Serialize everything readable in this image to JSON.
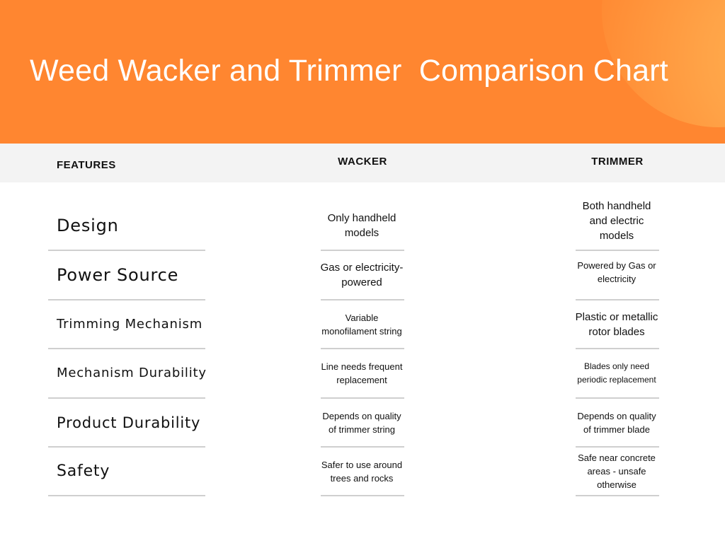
{
  "title": "Weed Wacker and Trimmer  Comparison Chart",
  "colors": {
    "banner": "#ff8630",
    "header_band": "#f3f3f3",
    "divider": "#cfcfcf"
  },
  "columns": {
    "features": "FEATURES",
    "wacker": "WACKER",
    "trimmer": "TRIMMER"
  },
  "rows": [
    {
      "feature": "Design",
      "wacker": "Only handheld models",
      "trimmer": "Both handheld and electric models"
    },
    {
      "feature": "Power Source",
      "wacker": "Gas or electricity-powered",
      "trimmer": "Powered by Gas or electricity"
    },
    {
      "feature": "Trimming Mechanism",
      "wacker": "Variable monofilament string",
      "trimmer": "Plastic or metallic rotor blades"
    },
    {
      "feature": "Mechanism Durability",
      "wacker": "Line needs frequent replacement",
      "trimmer": "Blades only  need periodic replacement"
    },
    {
      "feature": "Product Durability",
      "wacker": "Depends on quality of trimmer string",
      "trimmer": "Depends on quality of trimmer blade"
    },
    {
      "feature": "Safety",
      "wacker": "Safer to use around trees and rocks",
      "trimmer": "Safe near concrete areas - unsafe otherwise"
    }
  ]
}
